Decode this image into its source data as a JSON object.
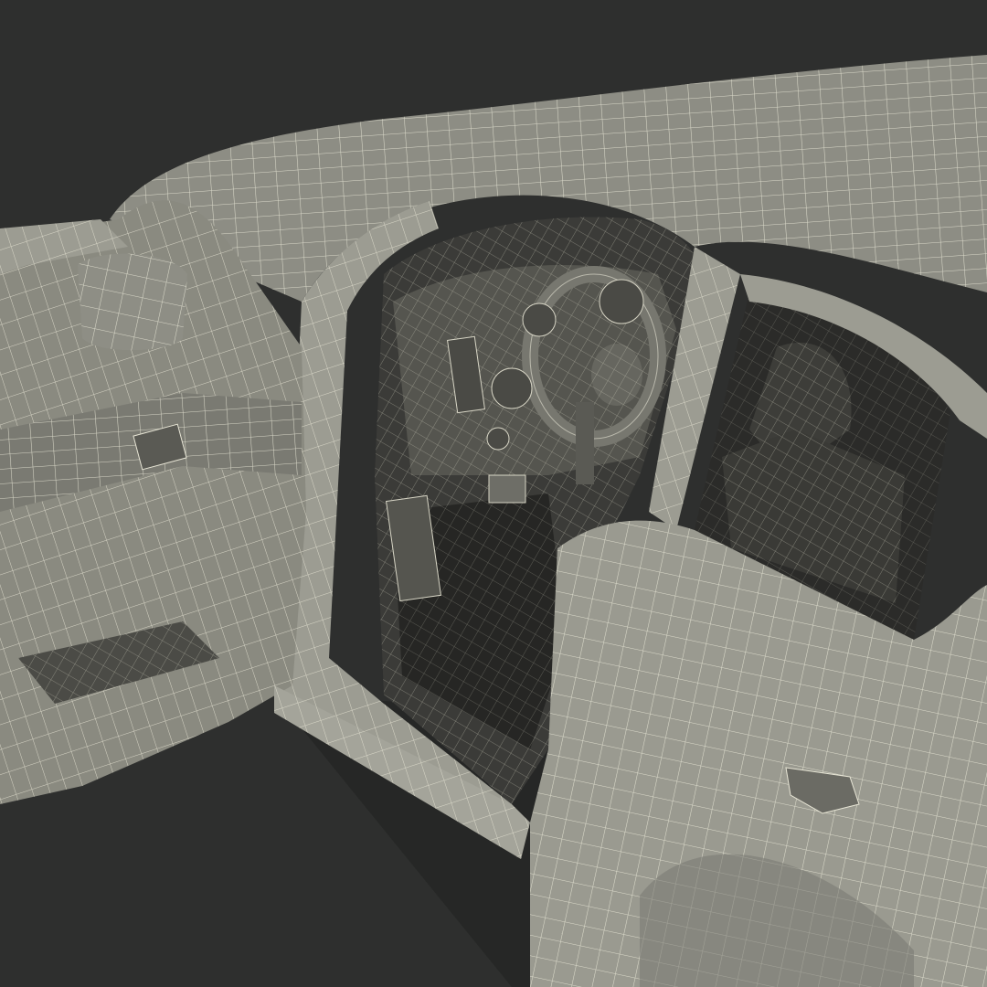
{
  "scene": {
    "subject": "wireframe-car-open-door",
    "colors": {
      "background": "#2e2f2e",
      "body_fill": "#8a8a80",
      "body_light": "#9c9c92",
      "body_dark": "#6a6a62",
      "interior": "#3b3b38",
      "interior_deep": "#262624",
      "wire": "#e8e6d6"
    }
  }
}
